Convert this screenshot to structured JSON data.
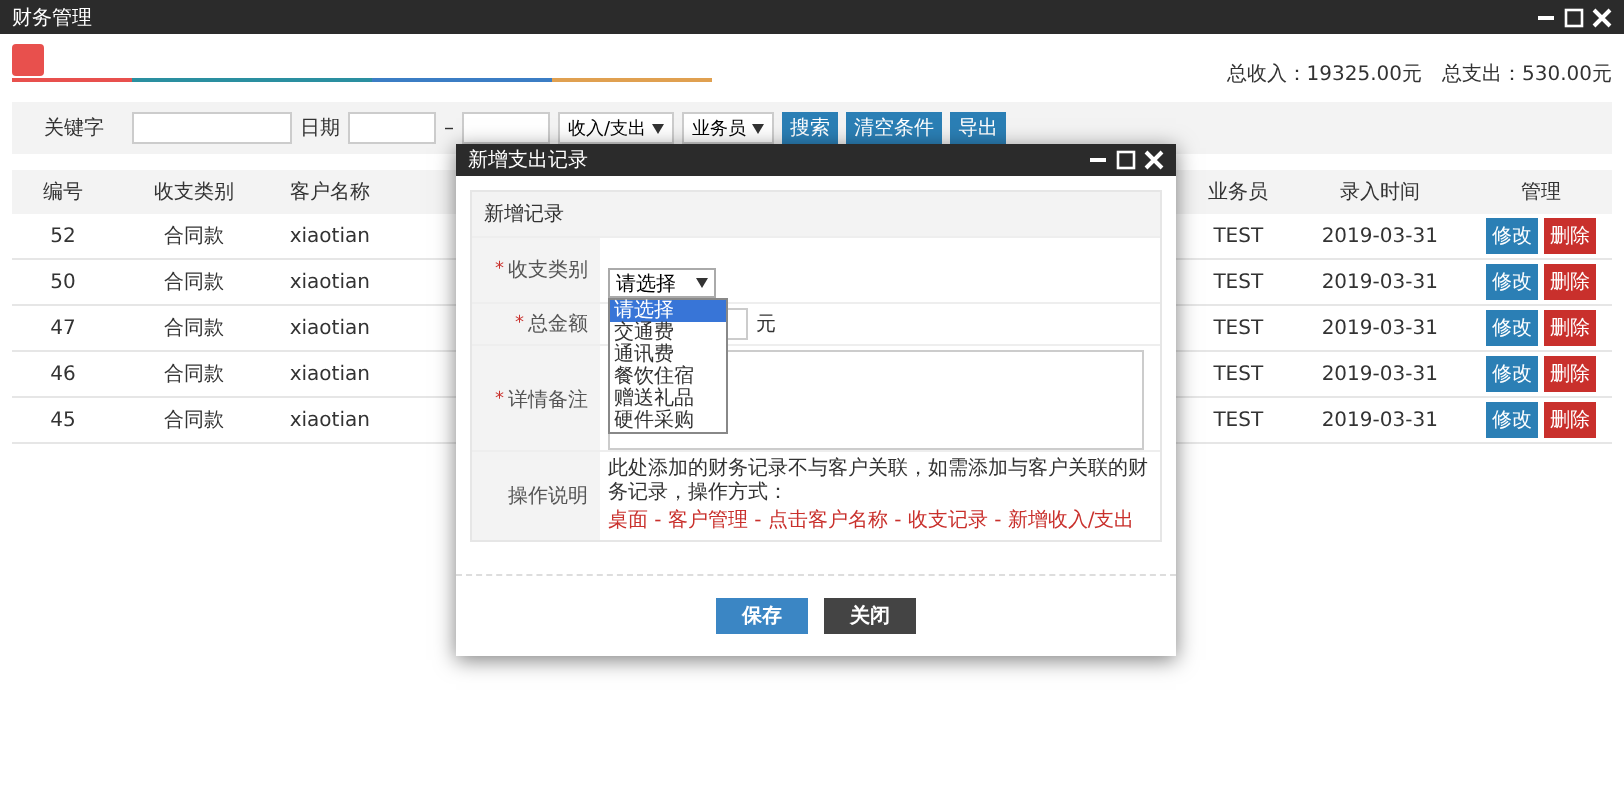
{
  "window": {
    "title": "财务管理"
  },
  "summary": {
    "income": "总收入：19325.00元",
    "expense": "总支出：530.00元"
  },
  "filters": {
    "keyword_label": "关键字",
    "date_label": "日期",
    "date_separator": "–",
    "type_select": "收入/支出",
    "staff_select": "业务员",
    "buttons": [
      "搜索",
      "清空条件",
      "导出"
    ]
  },
  "table": {
    "columns": [
      "编号",
      "收支类别",
      "客户名称",
      "业务员",
      "录入时间",
      "管理"
    ],
    "rows": [
      {
        "id": "52",
        "category": "合同款",
        "customer": "xiaotian",
        "staff": "TEST",
        "date": "2019-03-31",
        "actions": [
          "修改",
          "删除"
        ]
      },
      {
        "id": "50",
        "category": "合同款",
        "customer": "xiaotian",
        "staff": "TEST",
        "date": "2019-03-31",
        "actions": [
          "修改",
          "删除"
        ]
      },
      {
        "id": "47",
        "category": "合同款",
        "customer": "xiaotian",
        "staff": "TEST",
        "date": "2019-03-31",
        "actions": [
          "修改",
          "删除"
        ]
      },
      {
        "id": "46",
        "category": "合同款",
        "customer": "xiaotian",
        "staff": "TEST",
        "date": "2019-03-31",
        "actions": [
          "修改",
          "删除"
        ]
      },
      {
        "id": "45",
        "category": "合同款",
        "customer": "xiaotian",
        "staff": "TEST",
        "date": "2019-03-31",
        "actions": [
          "修改",
          "删除"
        ]
      }
    ]
  },
  "dialog": {
    "title": "新增支出记录",
    "heading": "新增记录",
    "category": {
      "required_mark": "*",
      "label": "收支类别",
      "value": "请选择",
      "options": [
        {
          "label": "请选择",
          "selected": true
        },
        {
          "label": "交通费",
          "selected": false
        },
        {
          "label": "通讯费",
          "selected": false
        },
        {
          "label": "餐饮住宿",
          "selected": false
        },
        {
          "label": "赠送礼品",
          "selected": false
        },
        {
          "label": "硬件采购",
          "selected": false
        }
      ]
    },
    "amount": {
      "required_mark": "*",
      "label": "总金额",
      "unit": "元"
    },
    "notes": {
      "required_mark": "*",
      "label": "详情备注"
    },
    "instructions": {
      "label": "操作说明",
      "text": "此处添加的财务记录不与客户关联，如需添加与客户关联的财务记录，操作方式：",
      "path": "桌面 - 客户管理 - 点击客户名称 - 收支记录 - 新增收入/支出"
    },
    "buttons": {
      "save": "保存",
      "close": "关闭"
    }
  }
}
